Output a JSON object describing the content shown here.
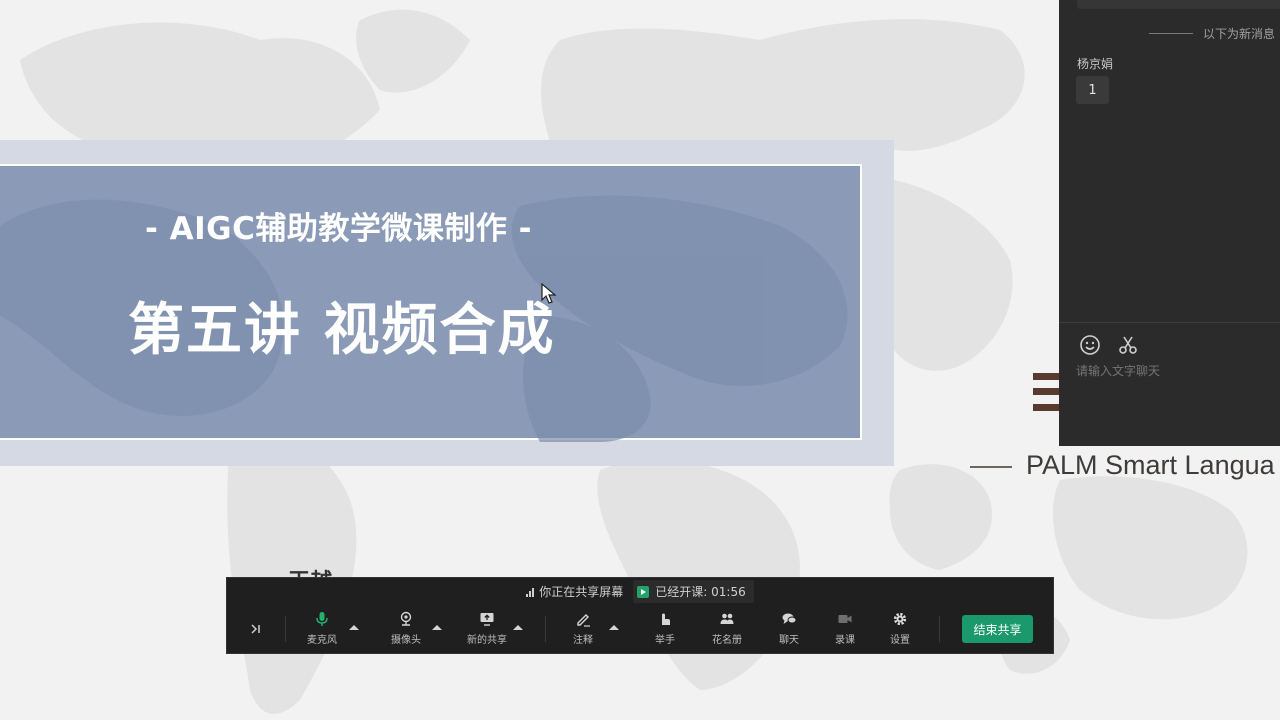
{
  "slide": {
    "subtitle": "- AIGC辅助教学微课制作 -",
    "title": "第五讲 视频合成",
    "palm_text": "PALM Smart Langua",
    "partial_text": "王越"
  },
  "chat": {
    "new_messages_label": "以下为新消息",
    "sender": "杨京娟",
    "message": "1",
    "input_placeholder": "请输入文字聊天",
    "icons": [
      "emoji-icon",
      "scissors-icon"
    ]
  },
  "toolbar": {
    "sharing_status": "你正在共享屏幕",
    "class_status": "已经开课: 01:56",
    "collapse_icon": "collapse-icon",
    "buttons": [
      {
        "label": "麦克风",
        "icon": "microphone-icon"
      },
      {
        "label": "摄像头",
        "icon": "camera-icon"
      },
      {
        "label": "新的共享",
        "icon": "share-screen-icon"
      },
      {
        "label": "注释",
        "icon": "pen-icon"
      },
      {
        "label": "举手",
        "icon": "raise-hand-icon"
      },
      {
        "label": "花名册",
        "icon": "roster-icon"
      },
      {
        "label": "聊天",
        "icon": "chat-icon"
      },
      {
        "label": "录课",
        "icon": "record-icon"
      },
      {
        "label": "设置",
        "icon": "gear-icon"
      }
    ],
    "end_share_label": "结束共享"
  },
  "colors": {
    "title_box": "#8a9ab7",
    "title_frame": "#d4d9e3",
    "mic_active": "#23b26d",
    "end_share": "#1a9a6c",
    "chat_bg": "#2b2b2b",
    "toolbar_bg": "#1f1f1f"
  }
}
